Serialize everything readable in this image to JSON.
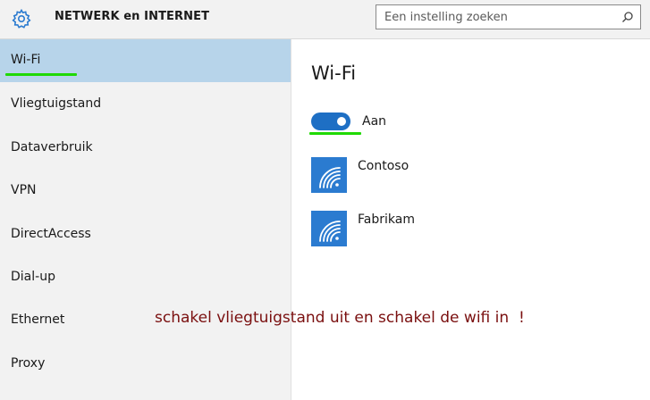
{
  "header": {
    "title": "NETWERK en INTERNET",
    "search_placeholder": "Een instelling zoeken",
    "icons": [
      "gear-icon",
      "search-icon"
    ]
  },
  "sidebar": {
    "items": [
      {
        "label": "Wi-Fi",
        "active": true
      },
      {
        "label": "Vliegtuigstand"
      },
      {
        "label": "Dataverbruik"
      },
      {
        "label": "VPN"
      },
      {
        "label": "DirectAccess"
      },
      {
        "label": "Dial-up"
      },
      {
        "label": "Ethernet"
      },
      {
        "label": "Proxy"
      }
    ]
  },
  "main": {
    "title": "Wi-Fi",
    "toggle": {
      "state": "on",
      "label": "Aan"
    },
    "networks": [
      {
        "name": "Contoso",
        "icon": "wifi-icon"
      },
      {
        "name": "Fabrikam",
        "icon": "wifi-icon"
      }
    ]
  },
  "annotation": {
    "text": "schakel vliegtuigstand uit en schakel de wifi in  !"
  },
  "colors": {
    "accent": "#2b7bd0",
    "toggle_on": "#1e6fc4",
    "selected_nav": "#b7d4ea",
    "highlight": "#1fd900",
    "annotation": "#7a0f0f"
  }
}
